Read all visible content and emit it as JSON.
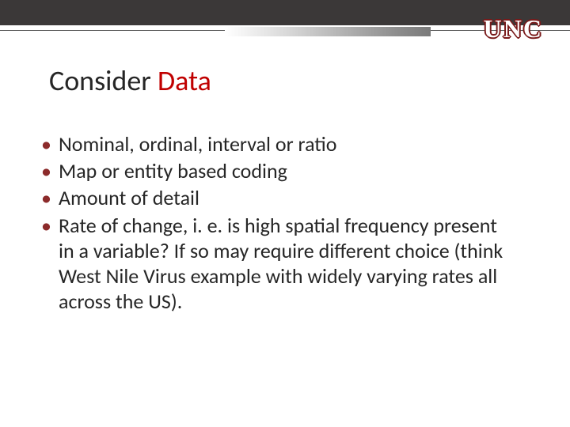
{
  "logo": "UNC",
  "title": {
    "prefix": "Consider ",
    "accent": "Data"
  },
  "bullets": [
    "Nominal, ordinal, interval or ratio",
    "Map or entity based coding",
    "Amount of detail",
    "Rate of change, i. e. is high spatial frequency present in a variable?  If so may require different choice (think West Nile Virus example with widely varying rates all across the US)."
  ]
}
